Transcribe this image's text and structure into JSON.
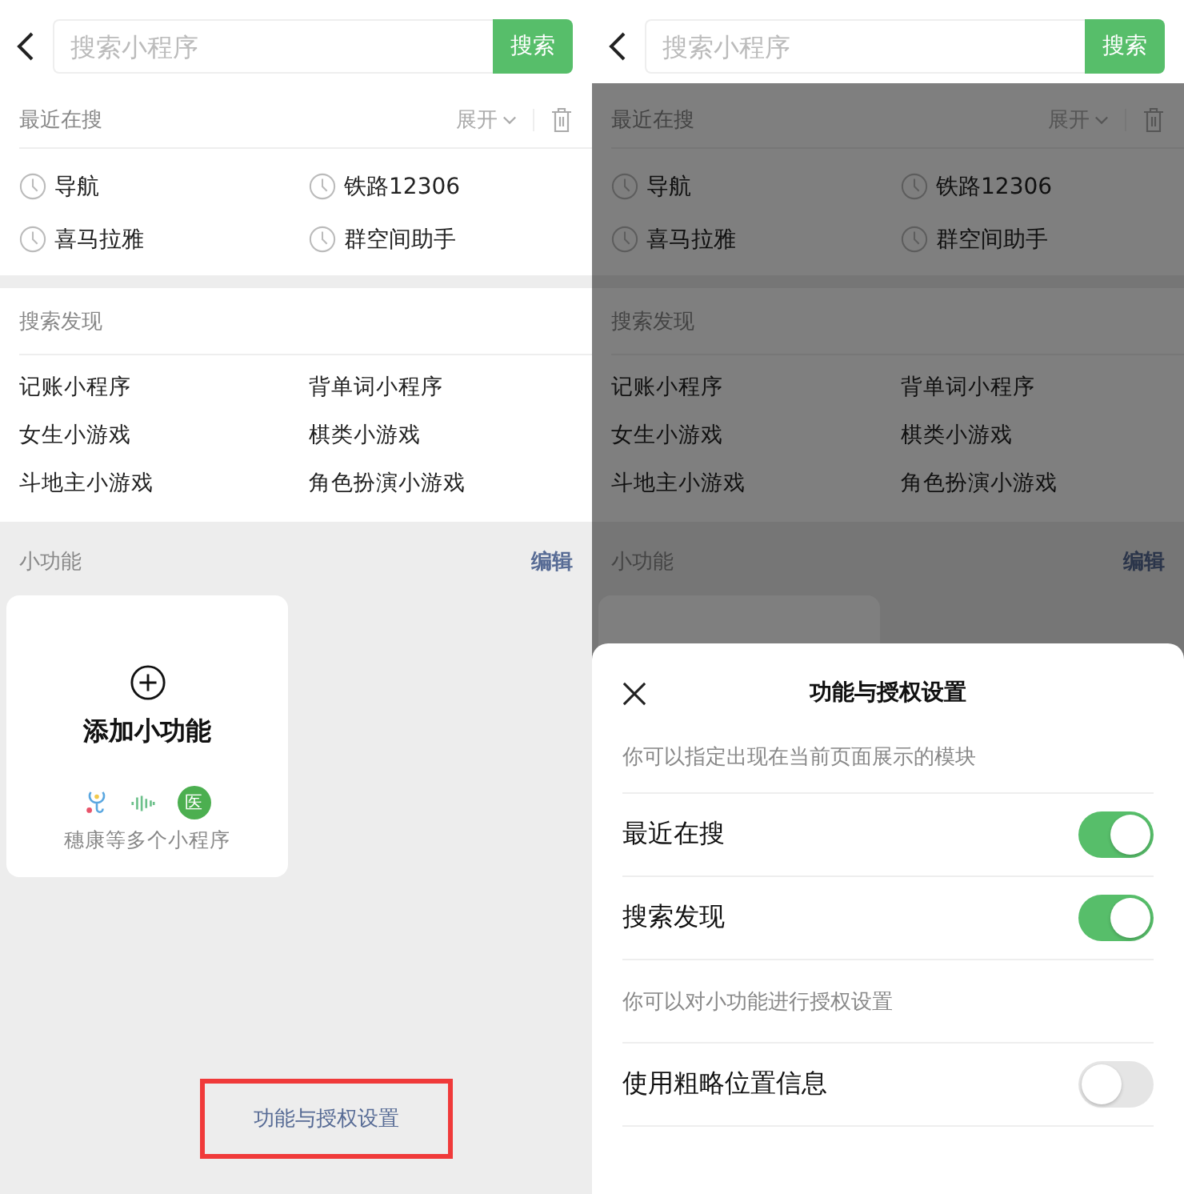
{
  "panels": [
    {
      "search": {
        "placeholder": "搜索小程序",
        "button": "搜索"
      },
      "recent": {
        "title": "最近在搜",
        "expand": "展开",
        "items": [
          "导航",
          "铁路12306",
          "喜马拉雅",
          "群空间助手"
        ]
      },
      "discover": {
        "title": "搜索发现",
        "items": [
          "记账小程序",
          "背单词小程序",
          "女生小游戏",
          "棋类小游戏",
          "斗地主小游戏",
          "角色扮演小游戏"
        ]
      },
      "mini": {
        "title": "小功能",
        "edit": "编辑",
        "card": {
          "kind": "add",
          "title": "添加小功能",
          "badge": "医",
          "caption": "穗康等多个小程序"
        }
      },
      "footer_link": {
        "text": "功能与授权设置",
        "highlighted": true
      }
    },
    {
      "search": {
        "placeholder": "搜索小程序",
        "button": "搜索"
      },
      "recent": {
        "title": "最近在搜",
        "expand": "展开",
        "items": [
          "导航",
          "铁路12306",
          "喜马拉雅",
          "群空间助手"
        ]
      },
      "discover": {
        "title": "搜索发现",
        "items": [
          "记账小程序",
          "背单词小程序",
          "女生小游戏",
          "棋类小游戏",
          "斗地主小游戏",
          "角色扮演小游戏"
        ]
      },
      "mini": {
        "title": "小功能",
        "edit": "编辑",
        "card": {
          "kind": "blank"
        }
      },
      "dimmed": true,
      "sheet": {
        "title": "功能与授权设置",
        "sections": [
          {
            "note": "你可以指定出现在当前页面展示的模块",
            "rows": [
              {
                "label": "最近在搜",
                "on": true
              },
              {
                "label": "搜索发现",
                "on": true
              }
            ]
          },
          {
            "note": "你可以对小功能进行授权设置",
            "rows": [
              {
                "label": "使用粗略位置信息",
                "on": false
              }
            ]
          }
        ]
      }
    }
  ]
}
